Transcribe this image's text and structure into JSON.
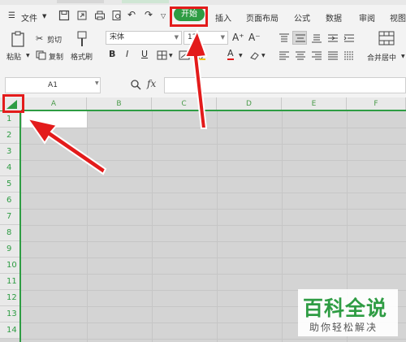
{
  "menubar": {
    "file_label": "文件",
    "tabs": [
      {
        "label": "开始",
        "active": true
      },
      {
        "label": "插入"
      },
      {
        "label": "页面布局"
      },
      {
        "label": "公式"
      },
      {
        "label": "数据"
      },
      {
        "label": "审阅"
      },
      {
        "label": "视图"
      }
    ]
  },
  "ribbon": {
    "paste_label": "粘贴",
    "cut_label": "剪切",
    "copy_label": "复制",
    "format_painter_label": "格式刷",
    "font_name": "宋体",
    "font_size": "12",
    "merge_label": "合并居中",
    "bold": "B",
    "italic": "I",
    "underline": "U",
    "font_color_letter": "A",
    "grow_font": "A⁺",
    "shrink_font": "A⁻"
  },
  "formula_bar": {
    "cell_ref": "A1",
    "fx_label": "fx"
  },
  "sheet": {
    "columns": [
      "A",
      "B",
      "C",
      "D",
      "E",
      "F"
    ],
    "rows": [
      "1",
      "2",
      "3",
      "4",
      "5",
      "6",
      "7",
      "8",
      "9",
      "10",
      "11",
      "12",
      "13",
      "14"
    ]
  },
  "watermark": {
    "title": "百科全说",
    "subtitle": "助你轻松解决"
  },
  "colors": {
    "accent": "#2e9c43",
    "annotation": "#e31b1b",
    "grid_bg": "#d4d4d4"
  }
}
